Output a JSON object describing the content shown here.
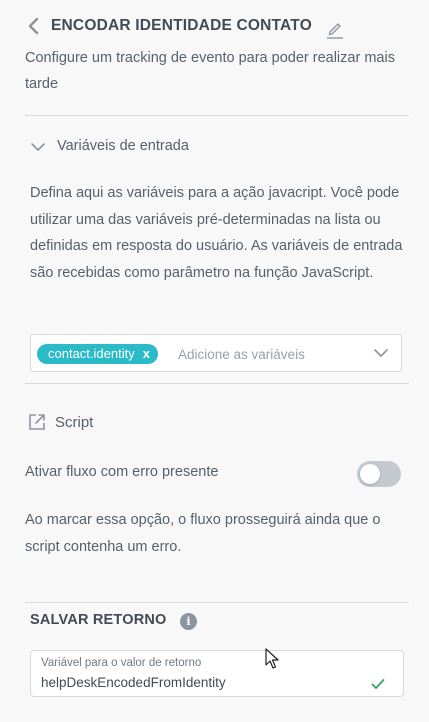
{
  "header": {
    "title": "ENCODAR IDENTIDADE CONTATO",
    "subtitle": "Configure um tracking de evento para poder realizar mais tarde"
  },
  "input_variables": {
    "section_label": "Variáveis de entrada",
    "description": "Defina aqui as variáveis para a ação javacript. Você pode utilizar uma das variáveis pré-determinadas na lista ou definidas em resposta do usuário. As variáveis de entrada são recebidas como parâmetro na função JavaScript.",
    "chip_label": "contact.identity",
    "chip_remove": "x",
    "placeholder": "Adicione as variáveis"
  },
  "script": {
    "label": "Script"
  },
  "error_flow": {
    "toggle_label": "Ativar fluxo com erro presente",
    "toggle_on": false,
    "description": "Ao marcar essa opção, o fluxo prosseguirá ainda que o script contenha um erro."
  },
  "save_return": {
    "title": "SALVAR RETORNO",
    "info_glyph": "i",
    "field_label": "Variável para o valor de retorno",
    "field_value": "helpDeskEncodedFromIdentity"
  },
  "colors": {
    "accent": "#2bbac7",
    "success": "#3aa55c",
    "text": "#56616d",
    "divider": "#d6dadf"
  }
}
